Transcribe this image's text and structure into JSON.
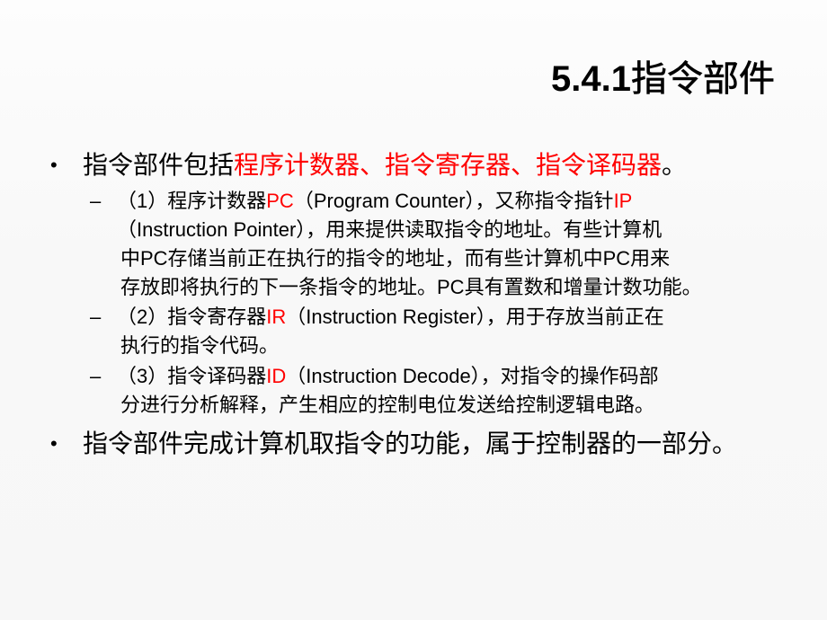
{
  "slide": {
    "title_number": "5.4.1",
    "title_text": "指令部件",
    "colors": {
      "text": "#000000",
      "highlight": "#ff0000",
      "background_top": "#fdfdfd",
      "background_bottom": "#f7f7f7"
    },
    "bullets": [
      {
        "marker": "•",
        "prefix": "指令部件包括",
        "highlight": "程序计数器、指令寄存器、指令译码器",
        "suffix": "。"
      },
      {
        "marker": "•",
        "text": "指令部件完成计算机取指令的功能，属于控制器的一部分。"
      }
    ],
    "sub_items": [
      {
        "marker": "–",
        "line1_prefix": "（1）程序计数器",
        "line1_abbr": "PC",
        "line1_mid": "（Program Counter），又称指令指针",
        "line1_abbr2": "IP",
        "line2": "（Instruction Pointer），用来提供读取指令的地址。有些计算机",
        "line3": "中PC存储当前正在执行的指令的地址，而有些计算机中PC用来",
        "line4": "存放即将执行的下一条指令的地址。PC具有置数和增量计数功能。"
      },
      {
        "marker": "–",
        "line1_prefix": "（2）指令寄存器",
        "line1_abbr": "IR",
        "line1_suffix": "（Instruction Register），用于存放当前正在",
        "line2": "执行的指令代码。"
      },
      {
        "marker": "–",
        "line1_prefix": "（3）指令译码器",
        "line1_abbr": "ID",
        "line1_suffix": "（Instruction Decode），对指令的操作码部",
        "line2": "分进行分析解释，产生相应的控制电位发送给控制逻辑电路。"
      }
    ]
  }
}
